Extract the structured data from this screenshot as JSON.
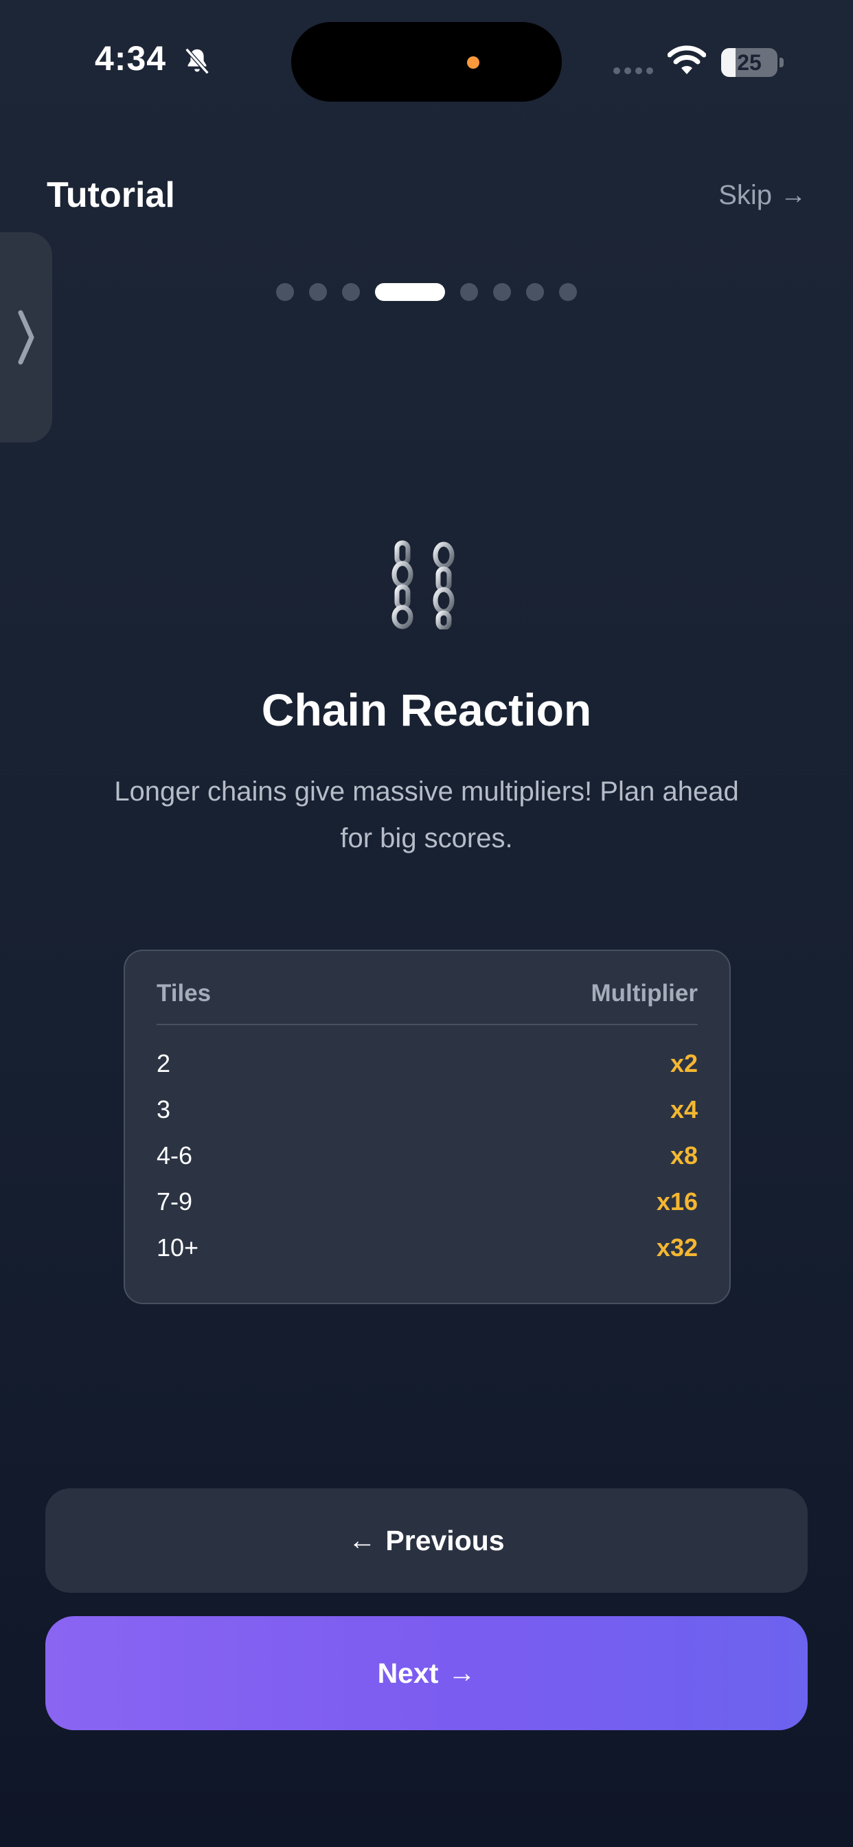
{
  "status_bar": {
    "time": "4:34",
    "battery_percent": "25",
    "battery_level": 25
  },
  "header": {
    "title": "Tutorial",
    "skip_label": "Skip",
    "skip_arrow": "→"
  },
  "pager": {
    "total": 8,
    "active_index": 3
  },
  "slide": {
    "icon": "chain-icon",
    "title": "Chain Reaction",
    "description": "Longer chains give massive multipliers! Plan ahead for big scores."
  },
  "table": {
    "headers": {
      "tiles": "Tiles",
      "multiplier": "Multiplier"
    },
    "rows": [
      {
        "tiles": "2",
        "multiplier": "x2"
      },
      {
        "tiles": "3",
        "multiplier": "x4"
      },
      {
        "tiles": "4-6",
        "multiplier": "x8"
      },
      {
        "tiles": "7-9",
        "multiplier": "x16"
      },
      {
        "tiles": "10+",
        "multiplier": "x32"
      }
    ]
  },
  "buttons": {
    "previous_label": "Previous",
    "previous_arrow": "←",
    "next_label": "Next",
    "next_arrow": "→"
  },
  "colors": {
    "accent_purple": "#8a65f2",
    "multiplier_gold": "#f5b731",
    "card_bg": "#2c3444"
  }
}
